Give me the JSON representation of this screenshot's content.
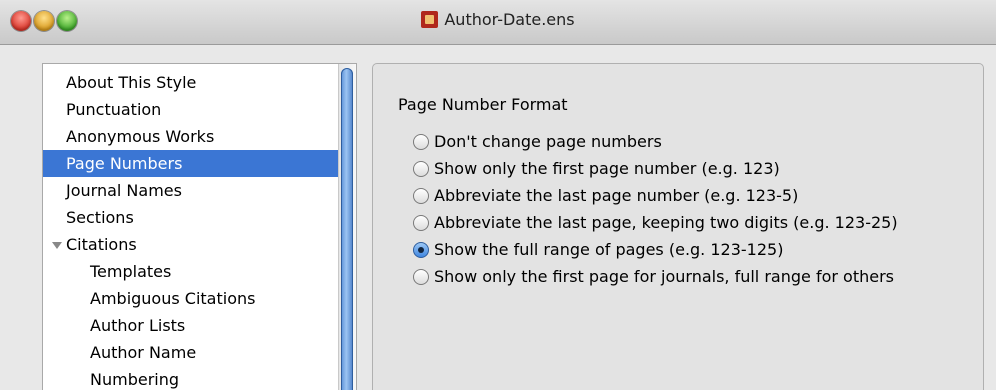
{
  "window": {
    "title": "Author-Date.ens",
    "title_icon": "endnote-document-icon"
  },
  "sidebar": {
    "items": [
      {
        "label": "About This Style"
      },
      {
        "label": "Punctuation"
      },
      {
        "label": "Anonymous Works"
      },
      {
        "label": "Page Numbers",
        "selected": true
      },
      {
        "label": "Journal Names"
      },
      {
        "label": "Sections"
      },
      {
        "label": "Citations",
        "expanded": true
      },
      {
        "label": "Templates"
      },
      {
        "label": "Ambiguous Citations"
      },
      {
        "label": "Author Lists"
      },
      {
        "label": "Author Name"
      },
      {
        "label": "Numbering"
      }
    ]
  },
  "panel": {
    "group_title": "Page Number Format",
    "options": [
      {
        "label": "Don't change page numbers",
        "checked": false
      },
      {
        "label": "Show only the first page number (e.g. 123)",
        "checked": false
      },
      {
        "label": "Abbreviate the last page number (e.g. 123-5)",
        "checked": false
      },
      {
        "label": "Abbreviate the last page, keeping two digits (e.g. 123-25)",
        "checked": false
      },
      {
        "label": "Show the full range of pages (e.g. 123-125)",
        "checked": true
      },
      {
        "label": "Show only the first page for journals, full range for others",
        "checked": false
      }
    ]
  },
  "colors": {
    "selection": "#3b76d4",
    "window_bg": "#e8e8e8"
  }
}
